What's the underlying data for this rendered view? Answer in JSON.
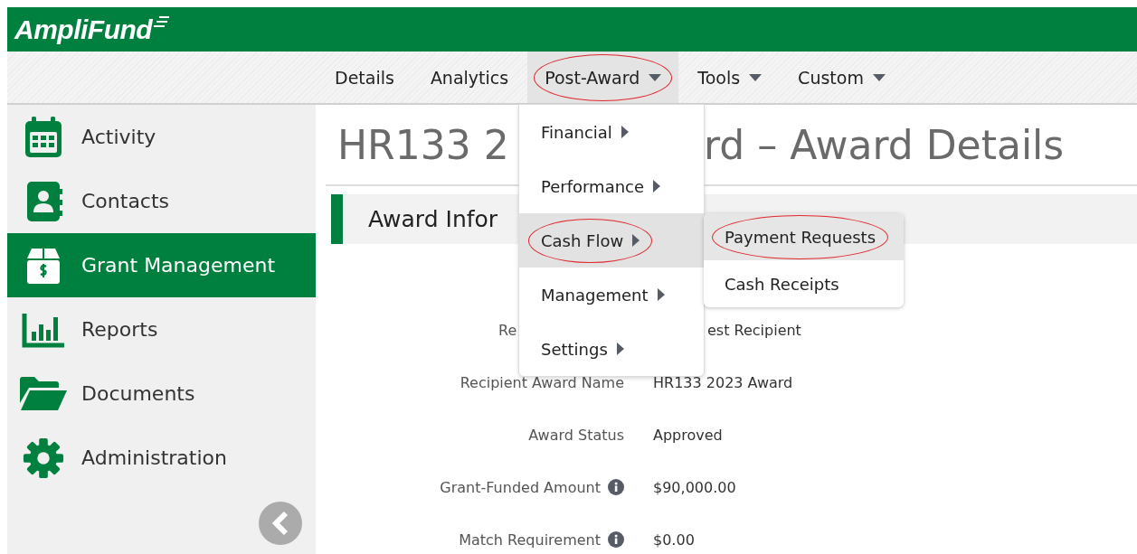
{
  "header": {
    "logo": "AmpliFund"
  },
  "nav": [
    {
      "label": "Details",
      "dropdown": false,
      "selected": false,
      "circled": false
    },
    {
      "label": "Analytics",
      "dropdown": false,
      "selected": false,
      "circled": false
    },
    {
      "label": "Post-Award",
      "dropdown": true,
      "selected": true,
      "circled": true
    },
    {
      "label": "Tools",
      "dropdown": true,
      "selected": false,
      "circled": false
    },
    {
      "label": "Custom",
      "dropdown": true,
      "selected": false,
      "circled": false
    }
  ],
  "sidebar": {
    "items": [
      {
        "label": "Activity",
        "kind": "calendar",
        "selected": false
      },
      {
        "label": "Contacts",
        "kind": "contact",
        "selected": false
      },
      {
        "label": "Grant Management",
        "kind": "box",
        "selected": true
      },
      {
        "label": "Reports",
        "kind": "chart",
        "selected": false
      },
      {
        "label": "Documents",
        "kind": "folder",
        "selected": false
      },
      {
        "label": "Administration",
        "kind": "gear",
        "selected": false
      }
    ]
  },
  "dropdown_menu": {
    "items": [
      {
        "label": "Financial",
        "selected": false,
        "circled": false
      },
      {
        "label": "Performance",
        "selected": false,
        "circled": false
      },
      {
        "label": "Cash Flow",
        "selected": true,
        "circled": true
      },
      {
        "label": "Management",
        "selected": false,
        "circled": false
      },
      {
        "label": "Settings",
        "selected": false,
        "circled": false
      }
    ]
  },
  "submenu": {
    "items": [
      {
        "label": "Payment Requests",
        "selected": true,
        "circled": true
      },
      {
        "label": "Cash Receipts",
        "selected": false,
        "circled": false
      }
    ]
  },
  "page": {
    "title_parts": [
      "HR133 2",
      "rd – Award Details"
    ],
    "section_heading": "Award Infor",
    "fields": [
      {
        "label": "Re",
        "value": "est Recipient",
        "kind": "covered"
      },
      {
        "label": "Recipient Award Name",
        "value": "HR133 2023 Award",
        "kind": "plain",
        "info": false
      },
      {
        "label": "Award Status",
        "value": "Approved",
        "kind": "plain",
        "info": false
      },
      {
        "label": "Grant-Funded Amount",
        "value": "$90,000.00",
        "kind": "plain",
        "info": true
      },
      {
        "label": "Match Requirement",
        "value": "$0.00",
        "kind": "plain",
        "info": true
      }
    ]
  }
}
